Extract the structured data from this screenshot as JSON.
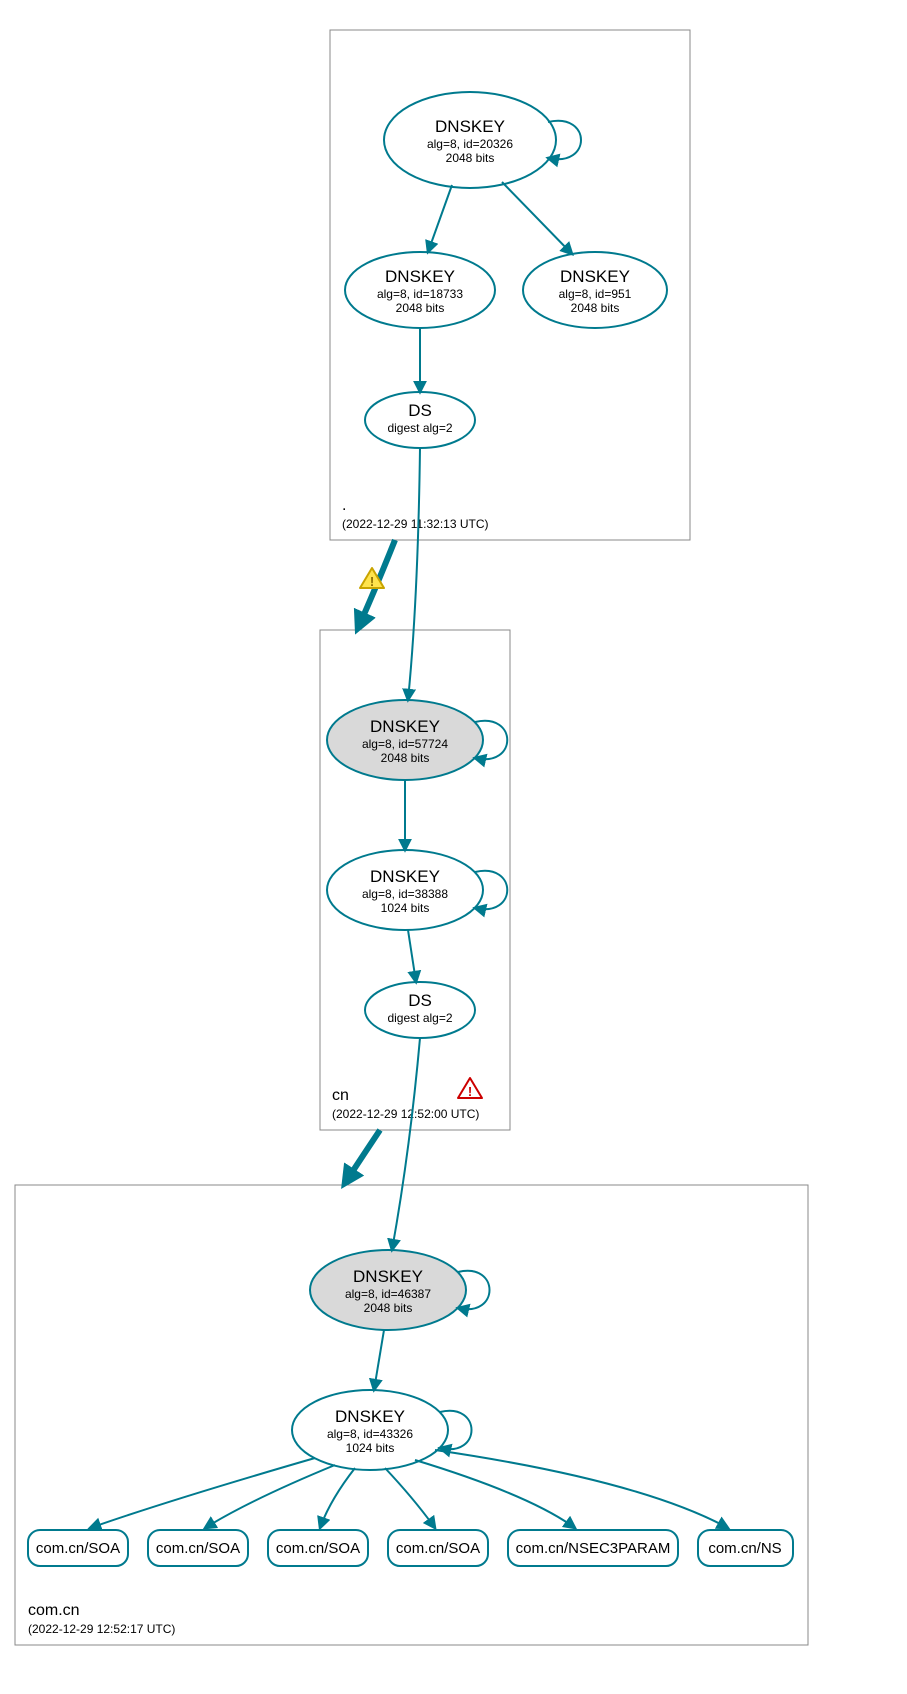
{
  "colors": {
    "teal": "#007a8e",
    "fillGrey": "#d9d9d9",
    "boxStroke": "#888888",
    "warnYellowFill": "#ffe44d",
    "warnYellowStroke": "#c9a400",
    "warnRedStroke": "#cc0000",
    "warnRedFill": "#ffffff"
  },
  "zones": {
    "root": {
      "label": ".",
      "timestamp": "(2022-12-29 11:32:13 UTC)"
    },
    "cn": {
      "label": "cn",
      "timestamp": "(2022-12-29 12:52:00 UTC)"
    },
    "comcn": {
      "label": "com.cn",
      "timestamp": "(2022-12-29 12:52:17 UTC)"
    }
  },
  "nodes": {
    "root_ksk": {
      "title": "DNSKEY",
      "line2": "alg=8, id=20326",
      "line3": "2048 bits"
    },
    "root_zsk1": {
      "title": "DNSKEY",
      "line2": "alg=8, id=18733",
      "line3": "2048 bits"
    },
    "root_zsk2": {
      "title": "DNSKEY",
      "line2": "alg=8, id=951",
      "line3": "2048 bits"
    },
    "root_ds": {
      "title": "DS",
      "line2": "digest alg=2",
      "line3": ""
    },
    "cn_ksk": {
      "title": "DNSKEY",
      "line2": "alg=8, id=57724",
      "line3": "2048 bits"
    },
    "cn_zsk": {
      "title": "DNSKEY",
      "line2": "alg=8, id=38388",
      "line3": "1024 bits"
    },
    "cn_ds": {
      "title": "DS",
      "line2": "digest alg=2",
      "line3": ""
    },
    "comcn_ksk": {
      "title": "DNSKEY",
      "line2": "alg=8, id=46387",
      "line3": "2048 bits"
    },
    "comcn_zsk": {
      "title": "DNSKEY",
      "line2": "alg=8, id=43326",
      "line3": "1024 bits"
    }
  },
  "rrsets": {
    "r0": "com.cn/SOA",
    "r1": "com.cn/SOA",
    "r2": "com.cn/SOA",
    "r3": "com.cn/SOA",
    "r4": "com.cn/NSEC3PARAM",
    "r5": "com.cn/NS"
  }
}
